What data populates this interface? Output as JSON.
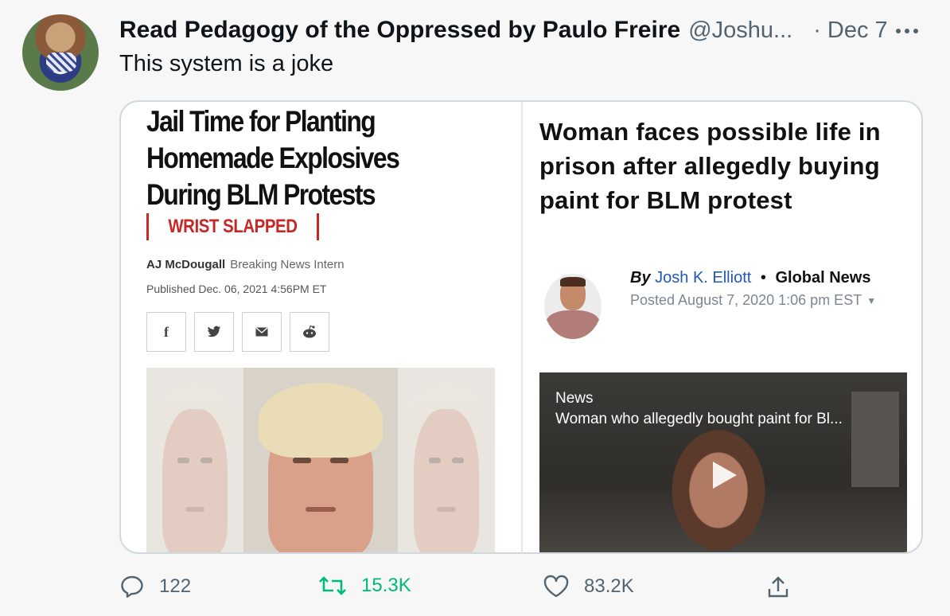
{
  "tweet": {
    "display_name": "Read Pedagogy of the Oppressed by Paulo Freire",
    "handle": "@Joshu...",
    "date": "· Dec 7",
    "text": "This system is a joke"
  },
  "left_article": {
    "headline": "Jail Time for Planting Homemade Explosives During BLM Protests",
    "tag": "WRIST SLAPPED",
    "author": "AJ McDougall",
    "author_role": "Breaking News Intern",
    "published": "Published Dec. 06, 2021 4:56PM ET",
    "share_icons": [
      "facebook-icon",
      "twitter-icon",
      "email-icon",
      "reddit-icon"
    ]
  },
  "right_article": {
    "headline": "Woman faces possible life in prison after allegedly buying paint for BLM protest",
    "by": "By",
    "author": "Josh K. Elliott",
    "separator": "•",
    "outlet": "Global News",
    "posted": "Posted August 7, 2020 1:06 pm EST",
    "video_label": "News",
    "video_title": "Woman who allegedly bought paint for Bl..."
  },
  "actions": {
    "replies": "122",
    "retweets": "15.3K",
    "likes": "83.2K"
  },
  "colors": {
    "retweet_green": "#00ba7c",
    "tag_red": "#c62828",
    "author_link_blue": "#1f5ab4",
    "muted_text": "#536471"
  }
}
